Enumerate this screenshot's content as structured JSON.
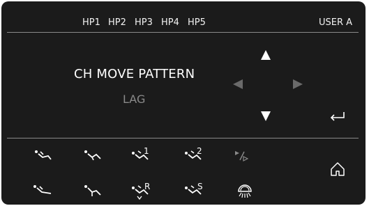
{
  "header": {
    "tabs": [
      {
        "label": "HP1"
      },
      {
        "label": "HP2"
      },
      {
        "label": "HP3"
      },
      {
        "label": "HP4"
      },
      {
        "label": "HP5"
      }
    ],
    "user": "USER A"
  },
  "main": {
    "title": "CH MOVE PATTERN",
    "subtitle": "LAG"
  },
  "icons": {
    "labels": {
      "r1c3": "1",
      "r1c4": "2",
      "r2c3": "R",
      "r2c4": "S"
    }
  },
  "colors": {
    "background": "#1b1b1b",
    "text": "#ffffff",
    "muted": "#8a8a8a"
  }
}
